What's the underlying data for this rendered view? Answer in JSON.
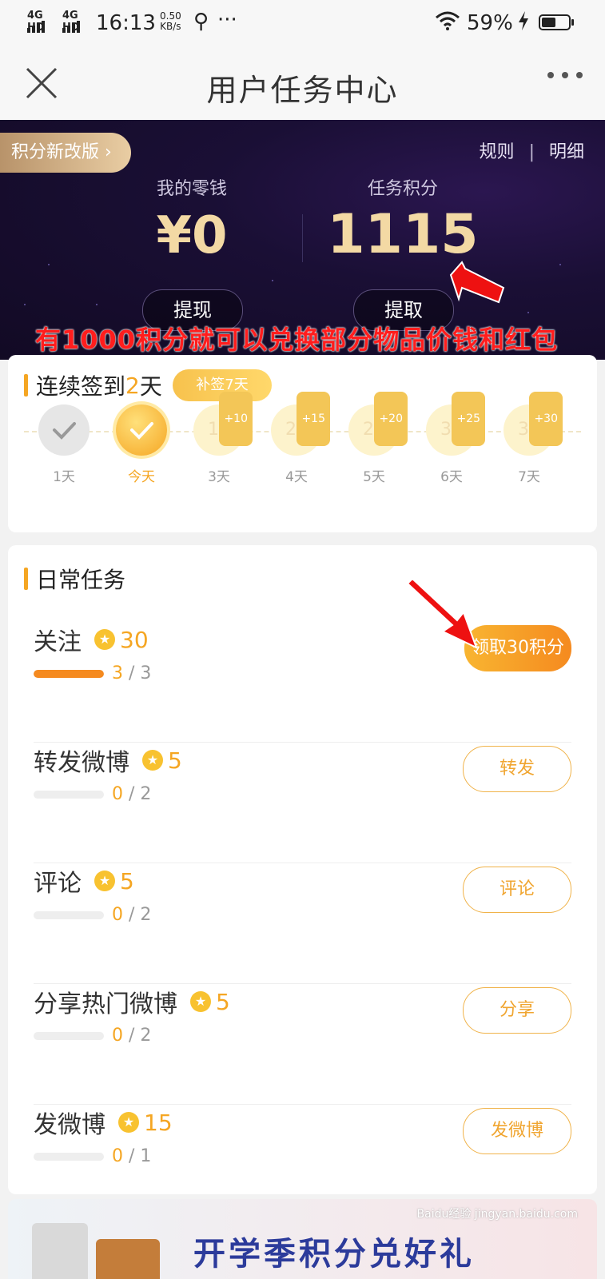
{
  "status_bar": {
    "signal1": "4G HD",
    "signal2": "4G HD",
    "time": "16:13",
    "speed_value": "0.50",
    "speed_unit": "KB/s",
    "more": "···",
    "battery_percent": "59%",
    "battery_level": 0.59
  },
  "nav": {
    "title": "用户任务中心"
  },
  "hero": {
    "promo_label": "积分新改版 ›",
    "rules_link": "规则",
    "divider": "|",
    "details_link": "明细",
    "wallet_label": "我的零钱",
    "wallet_value": "¥0",
    "points_label": "任务积分",
    "points_value": "1115",
    "withdraw_button": "提现",
    "redeem_button": "提取",
    "annotation_text": "有1000积分就可以兑换部分物品价钱和红包"
  },
  "checkin": {
    "title_prefix": "连续签到",
    "title_days": "2",
    "title_suffix": "天",
    "makeup_button": "补签7天",
    "days": [
      {
        "label": "1天",
        "state": "done",
        "value": "",
        "bonus": ""
      },
      {
        "label": "今天",
        "state": "today",
        "value": "",
        "bonus": ""
      },
      {
        "label": "3天",
        "state": "future",
        "value": "15",
        "bonus": "+10"
      },
      {
        "label": "4天",
        "state": "future",
        "value": "20",
        "bonus": "+15"
      },
      {
        "label": "5天",
        "state": "future",
        "value": "25",
        "bonus": "+20"
      },
      {
        "label": "6天",
        "state": "future",
        "value": "30",
        "bonus": "+25"
      },
      {
        "label": "7天",
        "state": "future",
        "value": "35",
        "bonus": "+30"
      }
    ]
  },
  "daily": {
    "title": "日常任务",
    "tasks": [
      {
        "name": "关注",
        "points": "30",
        "current": "3",
        "total": "3",
        "progress": 1.0,
        "button": "领取30积分",
        "claim": true
      },
      {
        "name": "转发微博",
        "points": "5",
        "current": "0",
        "total": "2",
        "progress": 0.0,
        "button": "转发",
        "claim": false
      },
      {
        "name": "评论",
        "points": "5",
        "current": "0",
        "total": "2",
        "progress": 0.0,
        "button": "评论",
        "claim": false
      },
      {
        "name": "分享热门微博",
        "points": "5",
        "current": "0",
        "total": "2",
        "progress": 0.0,
        "button": "分享",
        "claim": false
      },
      {
        "name": "发微博",
        "points": "15",
        "current": "0",
        "total": "1",
        "progress": 0.0,
        "button": "发微博",
        "claim": false
      }
    ]
  },
  "banner": {
    "title": "开学季积分兑好礼",
    "watermark": "Baidu经验 jingyan.baidu.com"
  },
  "colors": {
    "accent": "#f5a623",
    "annotation": "#ff1d1d",
    "hero_bg": "#1a0f35"
  }
}
